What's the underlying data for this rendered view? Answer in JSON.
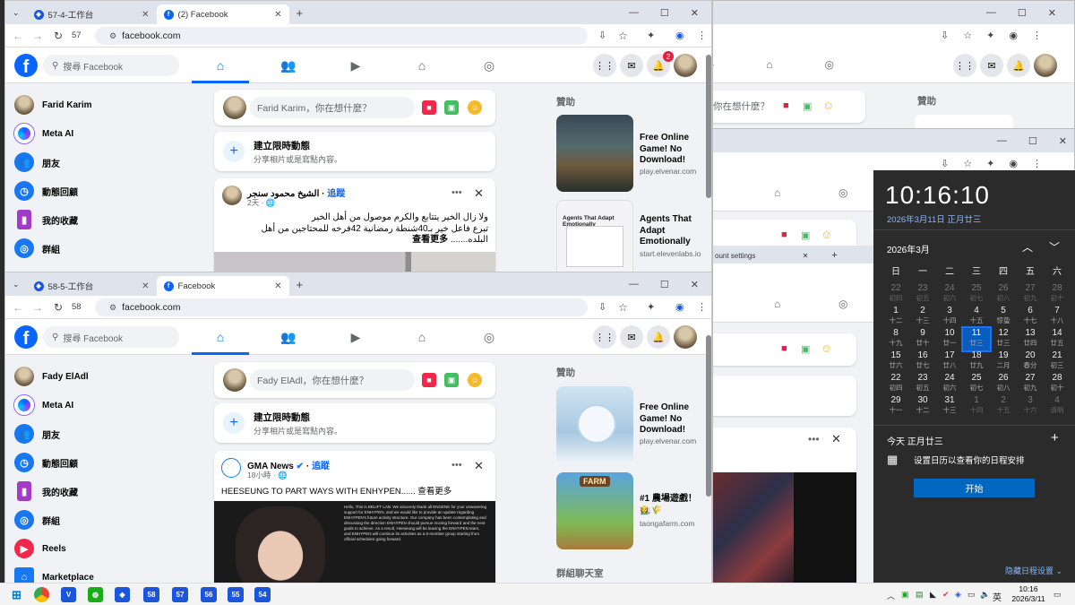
{
  "browser_top": {
    "tabs": [
      {
        "label": "57-4-工作台"
      },
      {
        "label": "(2) Facebook"
      }
    ],
    "address": "facebook.com",
    "profile_num": "57"
  },
  "browser_bottom": {
    "tabs": [
      {
        "label": "58-5-工作台"
      },
      {
        "label": "Facebook"
      }
    ],
    "address": "facebook.com",
    "profile_num": "58"
  },
  "fb_top": {
    "search_placeholder": "搜尋 Facebook",
    "notif_count": "2",
    "sidebar": [
      {
        "label": "Farid Karim",
        "icon": "avatar"
      },
      {
        "label": "Meta AI",
        "icon": "meta-ai-icon"
      },
      {
        "label": "朋友",
        "icon": "friends-icon"
      },
      {
        "label": "動態回顧",
        "icon": "memories-icon"
      },
      {
        "label": "我的收藏",
        "icon": "saved-icon"
      },
      {
        "label": "群組",
        "icon": "groups-icon"
      }
    ],
    "composer_placeholder": "Farid Karim，你在想什麼？",
    "story_title": "建立限時動態",
    "story_sub": "分享相片或是寫點內容。",
    "post_author": "الشيخ محمود سنجر",
    "post_follow": "追蹤",
    "post_time": "2天 · ",
    "post_text_1": "ولا زال الخير يتتابع والكرم موصول من أهل الخير",
    "post_text_2": "تبرع فاعل خير بـ40شنطة رمضانية 42فرخه للمحتاجين من أهل البلده.......",
    "post_more": "查看更多",
    "sponsored": "贊助",
    "ads": [
      {
        "title": "Free Online Game! No Download!",
        "domain": "play.elvenar.com"
      },
      {
        "title": "Agents That Adapt Emotionally",
        "domain": "start.elevenlabs.io",
        "img_text": "Agents That Adapt Emotionally"
      }
    ]
  },
  "fb_bottom": {
    "search_placeholder": "搜尋 Facebook",
    "sidebar": [
      {
        "label": "Fady ElAdl",
        "icon": "avatar"
      },
      {
        "label": "Meta AI",
        "icon": "meta-ai-icon"
      },
      {
        "label": "朋友",
        "icon": "friends-icon"
      },
      {
        "label": "動態回顧",
        "icon": "memories-icon"
      },
      {
        "label": "我的收藏",
        "icon": "saved-icon"
      },
      {
        "label": "群組",
        "icon": "groups-icon"
      },
      {
        "label": "Reels",
        "icon": "reels-icon"
      },
      {
        "label": "Marketplace",
        "icon": "marketplace-icon"
      }
    ],
    "composer_placeholder": "Fady ElAdl，你在想什麼？",
    "story_title": "建立限時動態",
    "story_sub": "分享相片或是寫點內容。",
    "post_author": "GMA News",
    "post_follow": "追蹤",
    "post_time": "18小時 · ",
    "post_text": "HEESEUNG TO PART WAYS WITH ENHYPEN...... 查看更多",
    "letter_text": "Hello, This is BELIFT LAB. We sincerely thank all ENGENE for your unwavering support for ENHYPEN, and we would like to provide an update regarding ENHYPEN's future activity structure. Our company has been contemplating and discussing the direction ENHYPEN should pursue moving forward and the next goals to achieve. As a result, Heeseung will be leaving the ENHYPEN team, and ENHYPEN will continue its activities as a 6-member group starting from official schedules going forward.",
    "sponsored": "贊助",
    "ads": [
      {
        "title": "Free Online Game! No Download!",
        "domain": "play.elvenar.com"
      },
      {
        "title": "#1 農場遊戲！👩‍🌾🌾",
        "domain": "taongafarm.com",
        "img_text": "FARM"
      }
    ],
    "group_chat": "群組聊天室"
  },
  "bg_right": {
    "sponsored": "贊助",
    "composer_partial": "你在想什麼？",
    "tab_partial": "ount settings"
  },
  "clock_panel": {
    "time": "10:16:10",
    "date_line": "2026年3月11日 正月廿三",
    "month": "2026年3月",
    "weekdays": [
      "日",
      "一",
      "二",
      "三",
      "四",
      "五",
      "六"
    ],
    "weeks": [
      [
        [
          "22",
          "初四",
          1
        ],
        [
          "23",
          "初五",
          1
        ],
        [
          "24",
          "初六",
          1
        ],
        [
          "25",
          "初七",
          1
        ],
        [
          "26",
          "初八",
          1
        ],
        [
          "27",
          "初九",
          1
        ],
        [
          "28",
          "初十",
          1
        ],
        [
          "1",
          "十二",
          0
        ]
      ],
      [
        [
          "1",
          "十二",
          0
        ],
        [
          "2",
          "十三",
          0
        ],
        [
          "3",
          "十四",
          0
        ],
        [
          "4",
          "十五",
          0
        ],
        [
          "5",
          "惊蛰",
          0
        ],
        [
          "6",
          "十七",
          0
        ],
        [
          "7",
          "十八",
          0
        ]
      ],
      [
        [
          "8",
          "十九",
          0
        ],
        [
          "9",
          "廿十",
          0
        ],
        [
          "10",
          "廿一",
          0
        ],
        [
          "11",
          "廿三",
          2
        ],
        [
          "12",
          "廿三",
          0
        ],
        [
          "13",
          "廿四",
          0
        ],
        [
          "14",
          "廿五",
          0
        ]
      ],
      [
        [
          "15",
          "廿六",
          0
        ],
        [
          "16",
          "廿七",
          0
        ],
        [
          "17",
          "廿八",
          0
        ],
        [
          "18",
          "廿九",
          0
        ],
        [
          "19",
          "二月",
          0
        ],
        [
          "20",
          "春分",
          0
        ],
        [
          "21",
          "初三",
          0
        ]
      ],
      [
        [
          "22",
          "初四",
          0
        ],
        [
          "23",
          "初五",
          0
        ],
        [
          "24",
          "初六",
          0
        ],
        [
          "25",
          "初七",
          0
        ],
        [
          "26",
          "初八",
          0
        ],
        [
          "27",
          "初九",
          0
        ],
        [
          "28",
          "初十",
          0
        ]
      ],
      [
        [
          "29",
          "十一",
          0
        ],
        [
          "30",
          "十二",
          0
        ],
        [
          "31",
          "十三",
          0
        ],
        [
          "1",
          "十四",
          1
        ],
        [
          "2",
          "十五",
          1
        ],
        [
          "3",
          "十六",
          1
        ],
        [
          "4",
          "清明",
          1
        ]
      ]
    ],
    "today_label": "今天 正月廿三",
    "schedule_prompt": "设置日历以查看你的日程安排",
    "start_button": "开始",
    "hide_schedule": "隐藏日程设置"
  },
  "taskbar": {
    "apps": [
      "58",
      "57",
      "56",
      "55",
      "54"
    ],
    "ime": "英",
    "time": "10:16",
    "date": "2026/3/11"
  }
}
